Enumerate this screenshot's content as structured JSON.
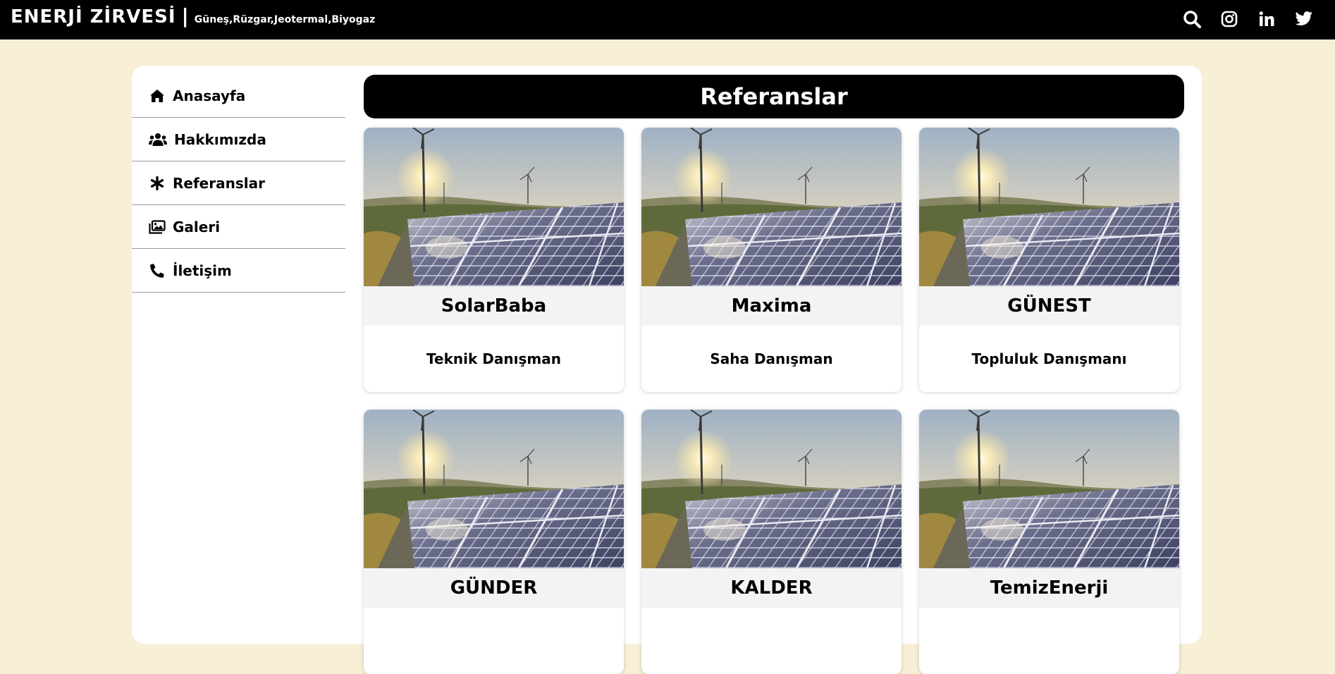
{
  "header": {
    "brand_title": "ENERJİ ZİRVESİ",
    "brand_sep": "|",
    "brand_subtitle": "Güneş,Rüzgar,Jeotermal,Biyogaz",
    "icons": [
      "search-icon",
      "instagram-icon",
      "linkedin-icon",
      "twitter-icon"
    ]
  },
  "sidebar": {
    "items": [
      {
        "label": "Anasayfa",
        "icon": "home-icon"
      },
      {
        "label": "Hakkımızda",
        "icon": "users-icon"
      },
      {
        "label": "Referanslar",
        "icon": "asterisk-icon"
      },
      {
        "label": "Galeri",
        "icon": "images-icon"
      },
      {
        "label": "İletişim",
        "icon": "phone-icon"
      }
    ]
  },
  "main": {
    "title": "Referanslar",
    "cards": [
      {
        "name": "SolarBaba",
        "role": "Teknik Danışman"
      },
      {
        "name": "Maxima",
        "role": "Saha Danışman"
      },
      {
        "name": "GÜNEST",
        "role": "Topluluk Danışmanı"
      },
      {
        "name": "GÜNDER",
        "role": ""
      },
      {
        "name": "KALDER",
        "role": ""
      },
      {
        "name": "TemizEnerji",
        "role": ""
      }
    ]
  },
  "colors": {
    "page_background": "#f7efd6",
    "header_background": "#000000",
    "panel_background": "#ffffff",
    "card_name_background": "#f3f3f3"
  }
}
